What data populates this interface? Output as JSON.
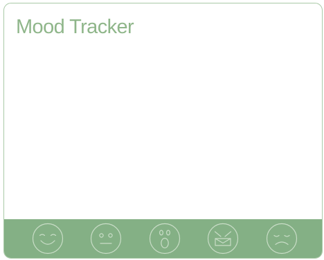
{
  "app": {
    "title": "Mood Tracker"
  },
  "theme": {
    "accent": "#84b085",
    "border": "#a9c9a6",
    "title_color": "#8fb68a",
    "icon_stroke": "#c9ddc7",
    "background": "#ffffff"
  },
  "moods": [
    {
      "name": "happy",
      "icon": "happy-face-icon"
    },
    {
      "name": "neutral",
      "icon": "neutral-face-icon"
    },
    {
      "name": "surprised",
      "icon": "surprised-face-icon"
    },
    {
      "name": "angry",
      "icon": "angry-face-icon"
    },
    {
      "name": "sad",
      "icon": "sad-face-icon"
    }
  ]
}
